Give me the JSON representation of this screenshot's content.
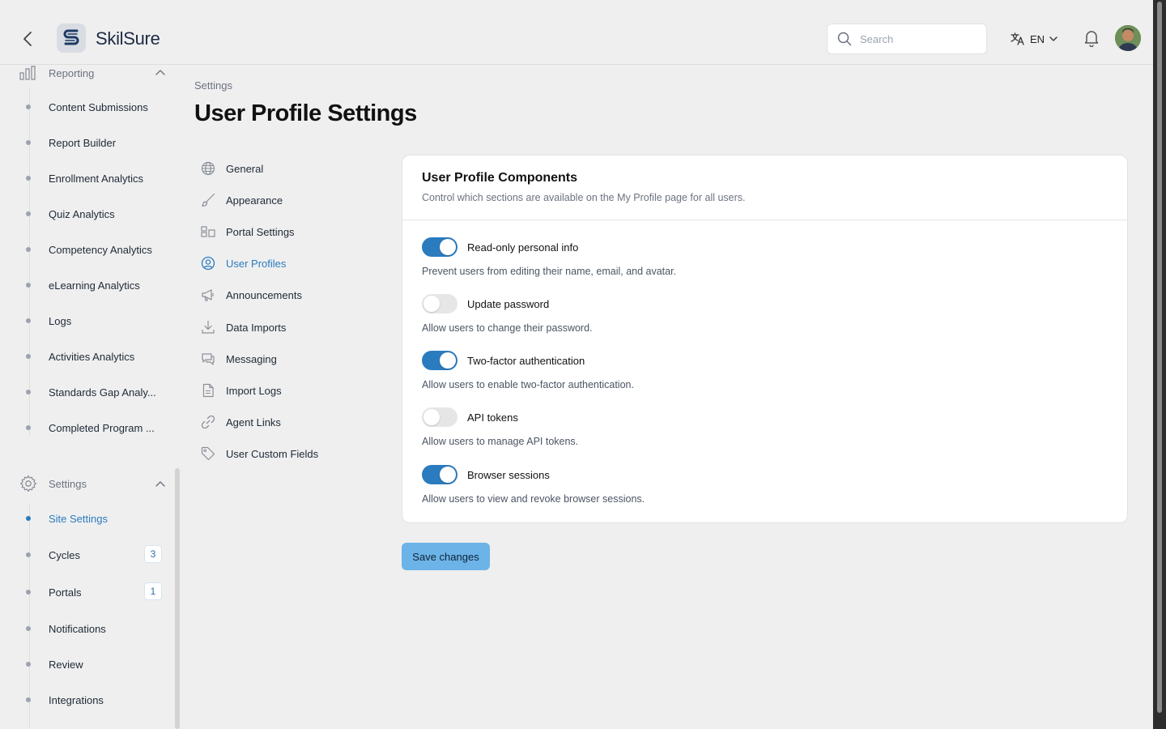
{
  "app": {
    "brand": "SkilSure"
  },
  "header": {
    "search_placeholder": "Search",
    "language": "EN"
  },
  "sidebar": {
    "reporting": {
      "label": "Reporting",
      "items": [
        {
          "label": "Content Submissions"
        },
        {
          "label": "Report Builder"
        },
        {
          "label": "Enrollment Analytics"
        },
        {
          "label": "Quiz Analytics"
        },
        {
          "label": "Competency Analytics"
        },
        {
          "label": "eLearning Analytics"
        },
        {
          "label": "Logs"
        },
        {
          "label": "Activities Analytics"
        },
        {
          "label": "Standards Gap Analy..."
        },
        {
          "label": "Completed Program ..."
        }
      ]
    },
    "settings": {
      "label": "Settings",
      "items": [
        {
          "label": "Site Settings",
          "active": true
        },
        {
          "label": "Cycles",
          "badge": "3"
        },
        {
          "label": "Portals",
          "badge": "1"
        },
        {
          "label": "Notifications"
        },
        {
          "label": "Review"
        },
        {
          "label": "Integrations"
        }
      ]
    }
  },
  "main": {
    "breadcrumb": "Settings",
    "title": "User Profile Settings",
    "subnav": [
      {
        "label": "General",
        "icon": "globe-icon"
      },
      {
        "label": "Appearance",
        "icon": "brush-icon"
      },
      {
        "label": "Portal Settings",
        "icon": "layout-icon"
      },
      {
        "label": "User Profiles",
        "icon": "user-circle-icon",
        "active": true
      },
      {
        "label": "Announcements",
        "icon": "megaphone-icon"
      },
      {
        "label": "Data Imports",
        "icon": "download-icon"
      },
      {
        "label": "Messaging",
        "icon": "chat-icon"
      },
      {
        "label": "Import Logs",
        "icon": "file-icon"
      },
      {
        "label": "Agent Links",
        "icon": "link-icon"
      },
      {
        "label": "User Custom Fields",
        "icon": "tag-icon"
      }
    ],
    "card": {
      "title": "User Profile Components",
      "description": "Control which sections are available on the My Profile page for all users.",
      "options": [
        {
          "label": "Read-only personal info",
          "help": "Prevent users from editing their name, email, and avatar.",
          "enabled": true
        },
        {
          "label": "Update password",
          "help": "Allow users to change their password.",
          "enabled": false
        },
        {
          "label": "Two-factor authentication",
          "help": "Allow users to enable two-factor authentication.",
          "enabled": true
        },
        {
          "label": "API tokens",
          "help": "Allow users to manage API tokens.",
          "enabled": false
        },
        {
          "label": "Browser sessions",
          "help": "Allow users to view and revoke browser sessions.",
          "enabled": true
        }
      ]
    },
    "save_label": "Save changes"
  },
  "colors": {
    "accent": "#2b7bbf",
    "save_button": "#6cb4e8"
  }
}
